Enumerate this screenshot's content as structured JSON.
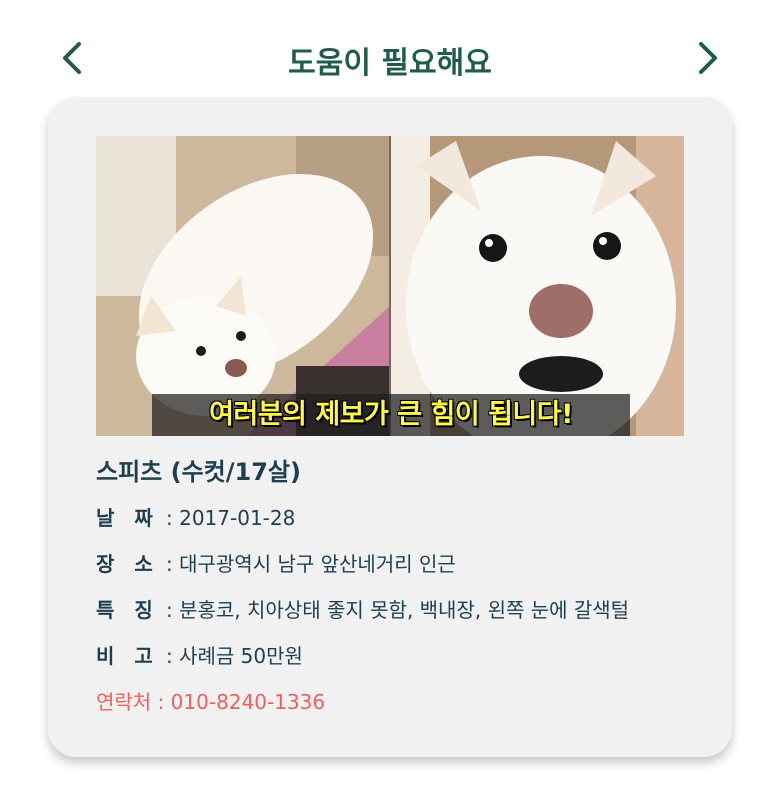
{
  "header": {
    "title": "도움이 필요해요",
    "prev_icon": "chevron-left-icon",
    "next_icon": "chevron-right-icon"
  },
  "card": {
    "photo_caption": "여러분의 제보가 큰 힘이 됩니다!",
    "pet_name": "스피츠 (수컷/17살)",
    "separator": ":",
    "details": [
      {
        "label": "날　짜",
        "value": "2017-01-28"
      },
      {
        "label": "장　소",
        "value": "대구광역시 남구 앞산네거리 인근"
      },
      {
        "label": "특　징",
        "value": "분홍코, 치아상태 좋지 못함, 백내장, 왼쪽 눈에 갈색털"
      },
      {
        "label": "비　고",
        "value": "사례금 50만원"
      }
    ],
    "contact": {
      "label": "연락처",
      "value": "010-8240-1336"
    }
  },
  "colors": {
    "title": "#1f5c4b",
    "text": "#1d3f50",
    "contact": "#ee6060",
    "card_bg": "#f1f1f1",
    "caption_text": "#fff64a"
  }
}
